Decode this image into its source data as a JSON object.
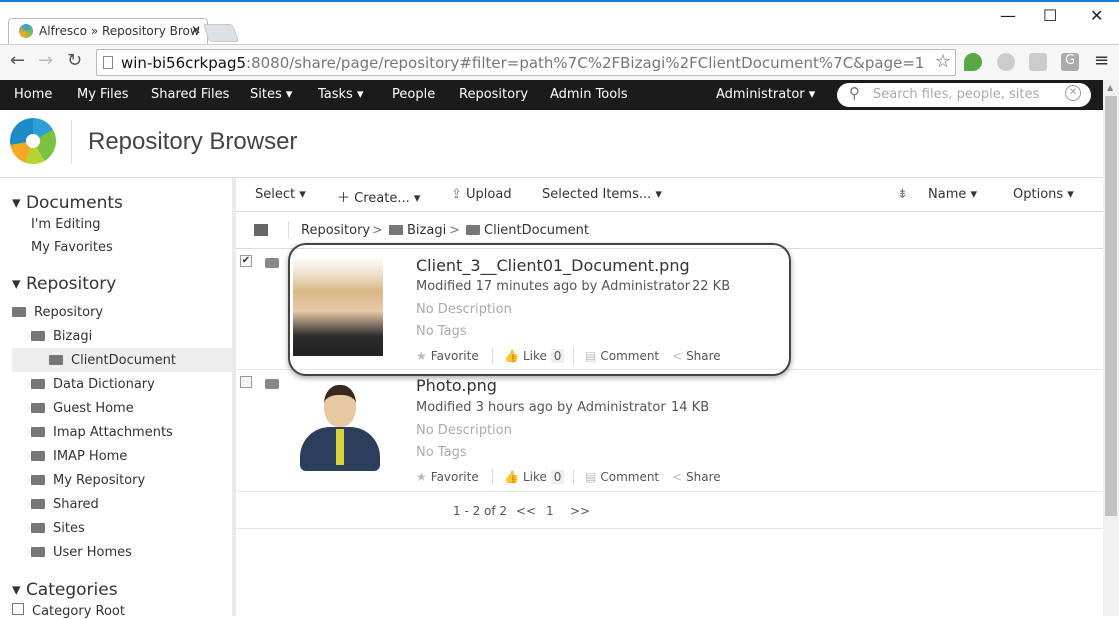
{
  "browser": {
    "tab_title": "Alfresco » Repository Brow",
    "url_host": "win-bi56crkpag5",
    "url_rest": ":8080/share/page/repository#filter=path%7C%2FBizagi%2FClientDocument%7C&page=1"
  },
  "nav": {
    "items": [
      "Home",
      "My Files",
      "Shared Files",
      "Sites ▾",
      "Tasks ▾",
      "People",
      "Repository",
      "Admin Tools"
    ],
    "user": "Administrator ▾",
    "search_placeholder": "Search files, people, sites"
  },
  "header": {
    "title": "Repository Browser"
  },
  "sidebar": {
    "documents_heading": "Documents",
    "documents": [
      "I'm Editing",
      "My Favorites"
    ],
    "repository_heading": "Repository",
    "root": "Repository",
    "bizagi": "Bizagi",
    "selected": "ClientDocument",
    "folders": [
      "Data Dictionary",
      "Guest Home",
      "Imap Attachments",
      "IMAP Home",
      "My Repository",
      "Shared",
      "Sites",
      "User Homes"
    ],
    "categories_heading": "Categories",
    "category_root": "Category Root"
  },
  "toolbar": {
    "select": "Select ▾",
    "create": "Create... ▾",
    "upload": "Upload",
    "selected_items": "Selected Items... ▾",
    "sort": "Name ▾",
    "options": "Options ▾"
  },
  "breadcrumb": [
    "Repository",
    "Bizagi",
    "ClientDocument"
  ],
  "files": [
    {
      "name": "Client_3__Client01_Document.png",
      "modified": "Modified 17 minutes ago by Administrator",
      "size": "22 KB",
      "description": "No Description",
      "tags": "No Tags",
      "checked": true,
      "likes": "0"
    },
    {
      "name": "Photo.png",
      "modified": "Modified 3 hours ago by Administrator",
      "size": "14 KB",
      "description": "No Description",
      "tags": "No Tags",
      "checked": false,
      "likes": "0"
    }
  ],
  "actions": {
    "favorite": "Favorite",
    "like": "Like",
    "comment": "Comment",
    "share": "Share"
  },
  "pagination": {
    "summary": "1 - 2 of 2",
    "prev": "<<",
    "page": "1",
    "next": ">>"
  },
  "colors": {
    "nav_bg": "#1b1b1b",
    "highlight_border": "#444444",
    "window_accent": "#1a7bd1"
  }
}
